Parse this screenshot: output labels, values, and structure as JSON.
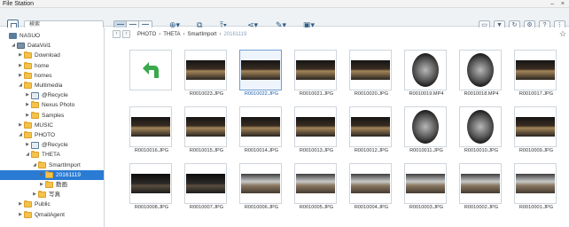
{
  "app": {
    "title": "File Station",
    "window_controls": "–  ×"
  },
  "toolbar": {
    "search_placeholder": "検索",
    "buttons": [
      "create-icon",
      "copy-icon",
      "upload-icon",
      "share-icon",
      "tools-icon",
      "remote-icon"
    ]
  },
  "sidebar": {
    "items": [
      {
        "label": "NASUO",
        "depth": 0,
        "icon": "nas-icon",
        "expanded": true
      },
      {
        "label": "DataVol1",
        "depth": 1,
        "icon": "disk-icon",
        "expanded": true
      },
      {
        "label": "Download",
        "depth": 2,
        "icon": "folder-icon"
      },
      {
        "label": "home",
        "depth": 2,
        "icon": "folder-icon"
      },
      {
        "label": "homes",
        "depth": 2,
        "icon": "folder-icon"
      },
      {
        "label": "Multimedia",
        "depth": 2,
        "icon": "folder-icon",
        "expanded": true
      },
      {
        "label": "@Recycle",
        "depth": 3,
        "icon": "recycle-icon"
      },
      {
        "label": "Nexus Photo",
        "depth": 3,
        "icon": "folder-icon"
      },
      {
        "label": "Samples",
        "depth": 3,
        "icon": "folder-icon"
      },
      {
        "label": "MUSIC",
        "depth": 2,
        "icon": "folder-icon"
      },
      {
        "label": "PHOTO",
        "depth": 2,
        "icon": "folder-icon",
        "expanded": true
      },
      {
        "label": "@Recycle",
        "depth": 3,
        "icon": "recycle-icon"
      },
      {
        "label": "THETA",
        "depth": 3,
        "icon": "folder-icon",
        "expanded": true
      },
      {
        "label": "SmartImport",
        "depth": 4,
        "icon": "folder-icon",
        "expanded": true
      },
      {
        "label": "20161119",
        "depth": 5,
        "icon": "folder-icon",
        "selected": true
      },
      {
        "label": "動画",
        "depth": 5,
        "icon": "folder-icon"
      },
      {
        "label": "写真",
        "depth": 4,
        "icon": "folder-icon"
      },
      {
        "label": "Public",
        "depth": 2,
        "icon": "folder-icon"
      },
      {
        "label": "QmailAgent",
        "depth": 2,
        "icon": "folder-icon"
      }
    ]
  },
  "breadcrumb": {
    "items": [
      "PHOTO",
      "THETA",
      "SmartImport",
      "20161119"
    ]
  },
  "files": [
    {
      "name": "",
      "kind": "back"
    },
    {
      "name": "R0010023.JPG",
      "kind": "pano"
    },
    {
      "name": "R0010022.JPG",
      "kind": "pano",
      "selected": true
    },
    {
      "name": "R0010021.JPG",
      "kind": "pano"
    },
    {
      "name": "R0010020.JPG",
      "kind": "pano"
    },
    {
      "name": "R0010019.MP4",
      "kind": "fish"
    },
    {
      "name": "R0010018.MP4",
      "kind": "fish"
    },
    {
      "name": "R0010017.JPG",
      "kind": "pano"
    },
    {
      "name": "R0010016.JPG",
      "kind": "pano"
    },
    {
      "name": "R0010015.JPG",
      "kind": "pano"
    },
    {
      "name": "R0010014.JPG",
      "kind": "pano"
    },
    {
      "name": "R0010013.JPG",
      "kind": "pano"
    },
    {
      "name": "R0010012.JPG",
      "kind": "pano"
    },
    {
      "name": "R0010011.JPG",
      "kind": "fish"
    },
    {
      "name": "R0010010.JPG",
      "kind": "fish"
    },
    {
      "name": "R0010009.JPG",
      "kind": "pano"
    },
    {
      "name": "R0010008.JPG",
      "kind": "dark"
    },
    {
      "name": "R0010007.JPG",
      "kind": "dark"
    },
    {
      "name": "R0010006.JPG",
      "kind": "bright"
    },
    {
      "name": "R0010005.JPG",
      "kind": "bright"
    },
    {
      "name": "R0010004.JPG",
      "kind": "bright"
    },
    {
      "name": "R0010003.JPG",
      "kind": "bright"
    },
    {
      "name": "R0010002.JPG",
      "kind": "bright"
    },
    {
      "name": "R0010001.JPG",
      "kind": "bright"
    }
  ]
}
